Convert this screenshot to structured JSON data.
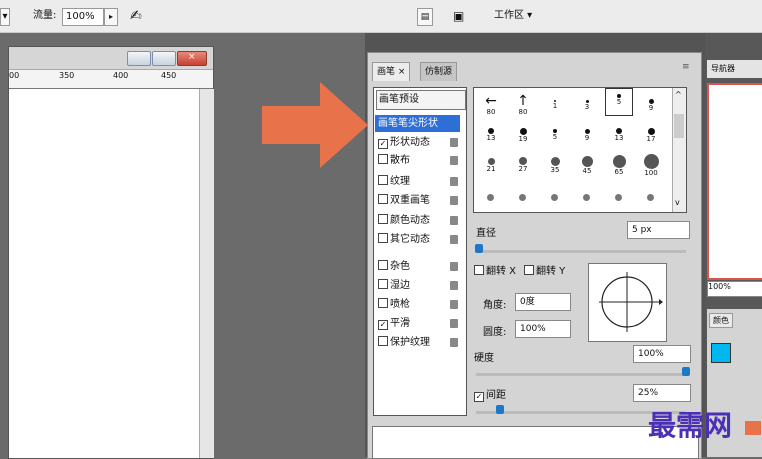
{
  "toolbar": {
    "flow_label": "流量:",
    "flow_value": "100%",
    "workspace_label": "工作区"
  },
  "document": {
    "ruler_ticks": [
      "00",
      "350",
      "400",
      "450"
    ]
  },
  "panel": {
    "tabs": [
      "画笔",
      "仿制源"
    ],
    "tab_close": "×",
    "brush_preset_button": "画笔预设",
    "options": [
      {
        "label": "画笔笔尖形状",
        "checked": null,
        "selected": true
      },
      {
        "label": "形状动态",
        "checked": true,
        "selected": false
      },
      {
        "label": "散布",
        "checked": false,
        "selected": false
      },
      {
        "label": "纹理",
        "checked": false,
        "selected": false
      },
      {
        "label": "双重画笔",
        "checked": false,
        "selected": false
      },
      {
        "label": "颜色动态",
        "checked": false,
        "selected": false
      },
      {
        "label": "其它动态",
        "checked": false,
        "selected": false
      },
      {
        "label": "杂色",
        "checked": false,
        "selected": false
      },
      {
        "label": "湿边",
        "checked": false,
        "selected": false
      },
      {
        "label": "喷枪",
        "checked": false,
        "selected": false
      },
      {
        "label": "平滑",
        "checked": true,
        "selected": false
      },
      {
        "label": "保护纹理",
        "checked": false,
        "selected": false
      }
    ],
    "brush_sizes": [
      [
        "80",
        "80",
        "1",
        "3",
        "5",
        "9"
      ],
      [
        "13",
        "19",
        "5",
        "9",
        "13",
        "17"
      ],
      [
        "21",
        "27",
        "35",
        "45",
        "65",
        "100"
      ]
    ],
    "diameter_label": "直径",
    "diameter_value": "5 px",
    "flip_x_label": "翻转 X",
    "flip_y_label": "翻转 Y",
    "angle_label": "角度:",
    "angle_value": "0度",
    "roundness_label": "圆度:",
    "roundness_value": "100%",
    "hardness_label": "硬度",
    "hardness_value": "100%",
    "spacing_label": "间距",
    "spacing_value": "25%"
  },
  "nav_panel": {
    "tab_label": "导航器",
    "zoom_value": "100%",
    "color_tab_label": "颜色"
  },
  "watermark": "最需网",
  "colors": {
    "arrow": "#e8734a",
    "selection": "#2d6fd6",
    "knob": "#1e78c8",
    "watermark": "#4b2fb5"
  }
}
